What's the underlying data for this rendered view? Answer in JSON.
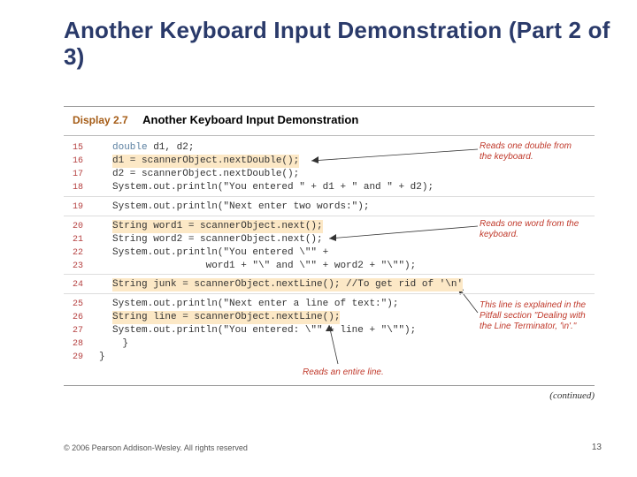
{
  "title": "Another Keyboard Input Demonstration (Part 2 of 3)",
  "display": {
    "label": "Display 2.7",
    "title": "Another Keyboard Input Demonstration"
  },
  "code": {
    "l15_kw": "double",
    "l15_rest": " d1, d2;",
    "l16": "d1 = scannerObject.nextDouble();",
    "l17": "d2 = scannerObject.nextDouble();",
    "l18": "System.out.println(\"You entered \" + d1 + \" and \" + d2);",
    "l19": "System.out.println(\"Next enter two words:\");",
    "l20": "String word1 = scannerObject.next();",
    "l21": "String word2 = scannerObject.next();",
    "l22": "System.out.println(\"You entered \\\"\" +",
    "l23": "                word1 + \"\\\" and \\\"\" + word2 + \"\\\"\");",
    "l24": "String junk = scannerObject.nextLine(); //To get rid of '\\n'",
    "l25": "System.out.println(\"Next enter a line of text:\");",
    "l26": "String line = scannerObject.nextLine();",
    "l27": "System.out.println(\"You entered: \\\"\" + line + \"\\\"\");",
    "l28": "    }",
    "l29": "}"
  },
  "ln": {
    "n15": "15",
    "n16": "16",
    "n17": "17",
    "n18": "18",
    "n19": "19",
    "n20": "20",
    "n21": "21",
    "n22": "22",
    "n23": "23",
    "n24": "24",
    "n25": "25",
    "n26": "26",
    "n27": "27",
    "n28": "28",
    "n29": "29"
  },
  "ann": {
    "a1": "Reads one double from the keyboard.",
    "a2": "Reads one word from the keyboard.",
    "a3": "This line is explained in the Pitfall section \"Dealing with the Line Terminator, '\\n'.\"",
    "a4": "Reads an entire line."
  },
  "continued": "(continued)",
  "footer": "© 2006 Pearson Addison-Wesley. All rights reserved",
  "pageno": "13"
}
